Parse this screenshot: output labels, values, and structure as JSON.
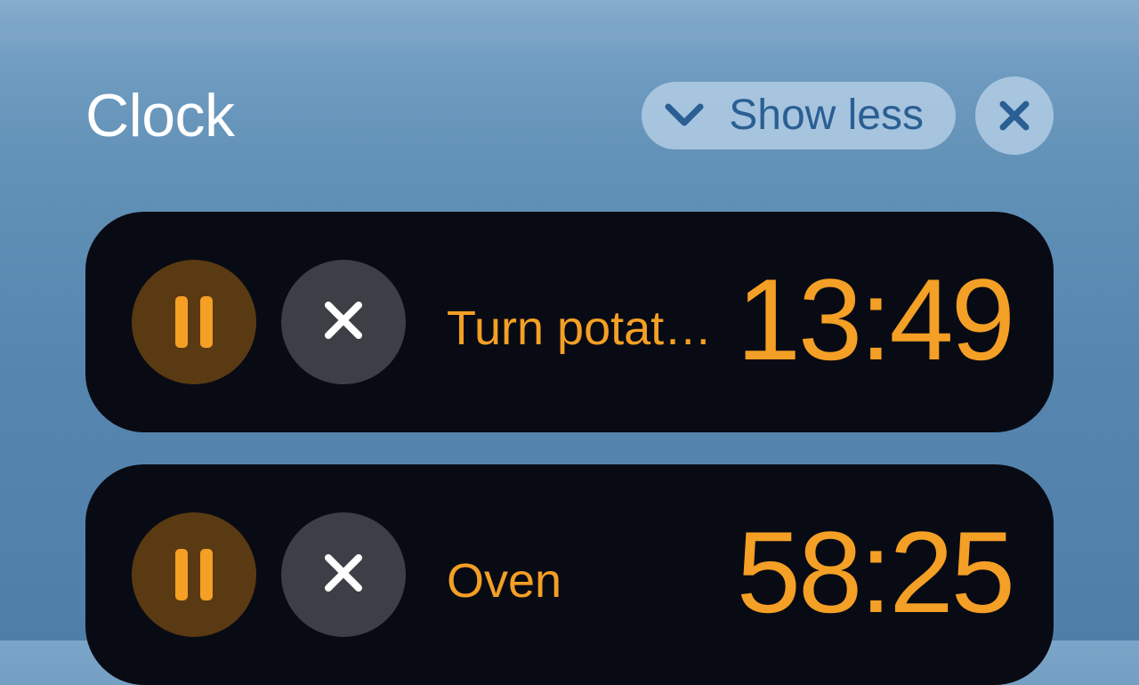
{
  "header": {
    "title": "Clock",
    "show_less_label": "Show less"
  },
  "colors": {
    "accent": "#f49f25",
    "pill_bg": "rgba(184,209,232,0.78)",
    "pill_fg": "#2a5f93",
    "card_bg": "#090b14"
  },
  "timers": [
    {
      "label": "Turn potat…",
      "time": "13:49"
    },
    {
      "label": "Oven",
      "time": "58:25"
    }
  ]
}
